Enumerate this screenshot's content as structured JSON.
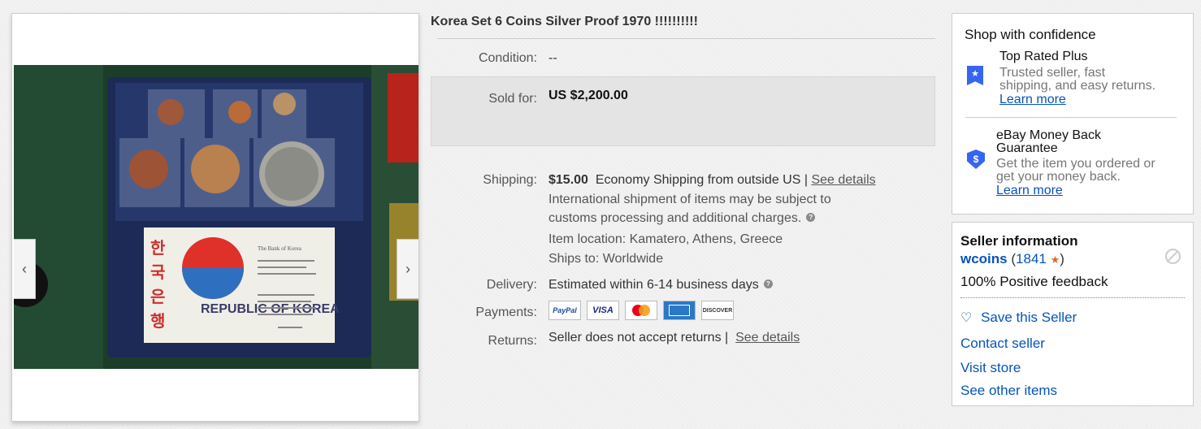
{
  "listing": {
    "title": "Korea Set 6 Coins Silver Proof 1970 !!!!!!!!!!",
    "condition_label": "Condition:",
    "condition_value": "--",
    "sold_label": "Sold for:",
    "sold_price": "US $2,200.00",
    "shipping_label": "Shipping:",
    "shipping_cost": "$15.00",
    "shipping_method": "Economy Shipping from outside US |",
    "shipping_details_link": "See details",
    "shipping_note_1": "International shipment of items may be subject to",
    "shipping_note_2": "customs processing and additional charges.",
    "item_location": "Item location: Kamatero, Athens, Greece",
    "ships_to": "Ships to: Worldwide",
    "delivery_label": "Delivery:",
    "delivery_value": "Estimated within 6-14 business days",
    "payments_label": "Payments:",
    "payment_methods": [
      "PayPal",
      "VISA",
      "Mastercard",
      "American Express",
      "Discover"
    ],
    "returns_label": "Returns:",
    "returns_value": "Seller does not accept returns |",
    "returns_details_link": "See details"
  },
  "image": {
    "photo_label": "REPUBLIC OF KOREA",
    "card_heading": "The Bank of Korea",
    "hangul": [
      "한",
      "국",
      "은",
      "행"
    ],
    "colors": {
      "felt": "#1b3d2a",
      "folder": "#1c2a55",
      "flag_red": "#e0302a",
      "flag_blue": "#2f6fc0"
    }
  },
  "confidence": {
    "heading": "Shop with confidence",
    "items": [
      {
        "title": "Top Rated Plus",
        "desc_1": "Trusted seller, fast",
        "desc_2": "shipping, and easy returns.",
        "link": "Learn more",
        "icon": "top-rated-badge-icon"
      },
      {
        "title_1": "eBay Money Back",
        "title_2": "Guarantee",
        "desc_1": "Get the item you ordered or",
        "desc_2": "get your money back.",
        "link": "Learn more",
        "icon": "money-back-shield-icon"
      }
    ]
  },
  "seller": {
    "heading": "Seller information",
    "name": "wcoins",
    "feedback_open": "(",
    "feedback_score": "1841",
    "feedback_close": ")",
    "positive": "100% Positive feedback",
    "save_seller": "Save this Seller",
    "contact": "Contact seller",
    "visit_store": "Visit store",
    "other_items": "See other items"
  },
  "colors": {
    "link": "#0654ba",
    "accent_blue": "#3665f3",
    "star": "#e0672c"
  }
}
